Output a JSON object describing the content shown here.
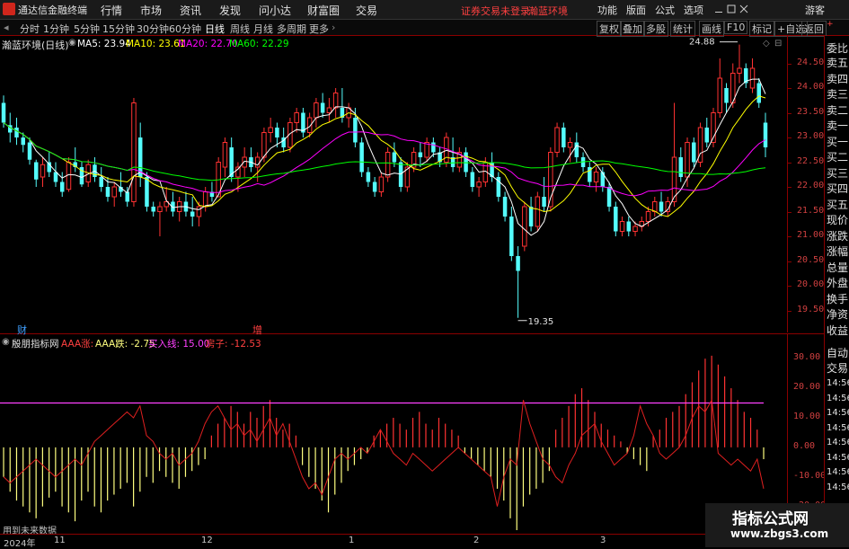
{
  "titlebar": {
    "app_title": "通达信金融终端",
    "menus": [
      "行情",
      "市场",
      "资讯",
      "发现",
      "问小达",
      "财富圈",
      "交易"
    ],
    "warning": "证券交易未登录",
    "stock_name": "瀚蓝环境",
    "right_menus": [
      "功能",
      "版面",
      "公式",
      "选项"
    ],
    "user": "游客"
  },
  "toolbar": {
    "periods": [
      "分时",
      "1分钟",
      "5分钟",
      "15分钟",
      "30分钟",
      "60分钟",
      "日线",
      "周线",
      "月线",
      "多周期",
      "更多"
    ],
    "selected": "日线",
    "right_buttons": [
      "复权",
      "叠加",
      "多股",
      "统计",
      "画线",
      "F10",
      "标记",
      "+自选",
      "返回"
    ]
  },
  "main_legend": {
    "title": "瀚蓝环境(日线)",
    "ma": [
      {
        "label": "MA5: 23.94",
        "color": "#ffffff"
      },
      {
        "label": "MA10: 23.61",
        "color": "#ffff00"
      },
      {
        "label": "MA20: 22.70",
        "color": "#ff00ff"
      },
      {
        "label": "MA60: 22.29",
        "color": "#00ff00"
      }
    ]
  },
  "sub_legend": {
    "title": "殷朋指标网",
    "items": [
      {
        "label": "AAA涨: ",
        "color": "#ff4040"
      },
      {
        "label": "AAA跌: -2.75",
        "color": "#ffff80"
      },
      {
        "label": "买入线: 15.00",
        "color": "#ff40ff"
      },
      {
        "label": "房子: -12.53",
        "color": "#ff4040"
      }
    ]
  },
  "annotations": {
    "high_label": "24.88",
    "low_label": "19.35",
    "marker_cai": "财",
    "marker_zeng": "增",
    "future_data": "用到未来数据"
  },
  "main_axis": {
    "ticks": [
      "24.50",
      "24.00",
      "23.50",
      "23.00",
      "22.50",
      "22.00",
      "21.50",
      "21.00",
      "20.50",
      "20.00",
      "19.50"
    ]
  },
  "sub_axis": {
    "ticks": [
      "30.00",
      "20.00",
      "10.00",
      "0.00",
      "-10.00",
      "-20.00"
    ]
  },
  "x_labels": {
    "year": "2024年",
    "months": [
      "11",
      "12",
      "1",
      "2",
      "3"
    ]
  },
  "right_panel": {
    "top": "委比",
    "items": [
      "卖五",
      "卖四",
      "卖三",
      "卖二",
      "卖一",
      "买一",
      "买二",
      "买三",
      "买四",
      "买五",
      "现价",
      "涨跌",
      "涨幅",
      "总量",
      "外盘",
      "换手",
      "净资",
      "收益"
    ],
    "auto": "自动",
    "trade": "交易",
    "times": [
      "14:56",
      "14:56",
      "14:56",
      "14:56",
      "14:56",
      "14:56",
      "14:56",
      "14:56"
    ]
  },
  "watermark": {
    "line1": "指标公式网",
    "line2": "www.zbgs3.com"
  },
  "chart_data": [
    {
      "type": "candlestick",
      "title": "瀚蓝环境(日线)",
      "ylim": [
        19.2,
        24.8
      ],
      "high": 24.88,
      "low": 19.35,
      "ohlc": [
        [
          23.7,
          23.85,
          23.2,
          23.3
        ],
        [
          23.25,
          23.5,
          22.9,
          23.1
        ],
        [
          23.2,
          23.4,
          22.85,
          23.0
        ],
        [
          23.0,
          23.1,
          22.7,
          22.85
        ],
        [
          22.9,
          23.0,
          22.45,
          22.55
        ],
        [
          22.5,
          22.55,
          22.0,
          22.15
        ],
        [
          22.2,
          22.6,
          22.0,
          22.45
        ],
        [
          22.5,
          22.7,
          22.2,
          22.3
        ],
        [
          22.3,
          22.5,
          22.0,
          22.1
        ],
        [
          22.1,
          22.3,
          21.8,
          21.9
        ],
        [
          21.95,
          22.6,
          21.9,
          22.5
        ],
        [
          22.5,
          22.8,
          22.3,
          22.4
        ],
        [
          22.4,
          22.5,
          22.0,
          22.05
        ],
        [
          22.1,
          22.55,
          22.0,
          22.45
        ],
        [
          22.45,
          22.6,
          22.1,
          22.2
        ],
        [
          22.2,
          22.4,
          21.9,
          22.0
        ],
        [
          22.0,
          22.2,
          21.7,
          21.8
        ],
        [
          21.8,
          22.1,
          21.6,
          22.0
        ],
        [
          22.0,
          22.3,
          21.8,
          21.9
        ],
        [
          21.9,
          22.0,
          21.6,
          21.7
        ],
        [
          21.7,
          23.8,
          21.6,
          23.7
        ],
        [
          23.0,
          23.3,
          22.0,
          22.2
        ],
        [
          22.2,
          22.3,
          21.5,
          21.6
        ],
        [
          21.6,
          21.7,
          21.4,
          21.5
        ],
        [
          21.5,
          21.7,
          21.0,
          21.6
        ],
        [
          21.6,
          22.0,
          21.5,
          21.7
        ],
        [
          21.7,
          21.9,
          21.4,
          21.5
        ],
        [
          21.5,
          21.8,
          21.3,
          21.7
        ],
        [
          21.7,
          21.9,
          21.4,
          21.5
        ],
        [
          21.5,
          21.8,
          21.2,
          21.4
        ],
        [
          21.4,
          21.7,
          21.2,
          21.6
        ],
        [
          21.6,
          22.0,
          21.5,
          21.9
        ],
        [
          21.9,
          22.1,
          21.7,
          21.8
        ],
        [
          21.8,
          22.6,
          21.8,
          22.5
        ],
        [
          22.4,
          23.0,
          22.2,
          22.9
        ],
        [
          22.8,
          23.0,
          22.1,
          22.2
        ],
        [
          22.2,
          22.5,
          21.9,
          22.4
        ],
        [
          22.4,
          22.8,
          22.2,
          22.6
        ],
        [
          22.6,
          22.8,
          22.3,
          22.4
        ],
        [
          22.4,
          22.7,
          22.1,
          22.6
        ],
        [
          22.6,
          23.2,
          22.5,
          23.1
        ],
        [
          23.1,
          23.4,
          22.9,
          23.2
        ],
        [
          23.2,
          23.3,
          22.8,
          23.0
        ],
        [
          23.0,
          23.2,
          22.7,
          22.8
        ],
        [
          22.8,
          23.4,
          22.7,
          23.3
        ],
        [
          23.3,
          23.6,
          23.1,
          23.5
        ],
        [
          23.5,
          23.6,
          23.0,
          23.1
        ],
        [
          23.1,
          23.5,
          23.0,
          23.4
        ],
        [
          23.4,
          23.8,
          23.2,
          23.7
        ],
        [
          23.7,
          23.9,
          23.4,
          23.5
        ],
        [
          23.5,
          23.8,
          23.3,
          23.6
        ],
        [
          23.6,
          24.0,
          23.4,
          23.9
        ],
        [
          23.6,
          24.0,
          23.3,
          23.4
        ],
        [
          23.4,
          23.7,
          23.2,
          23.6
        ],
        [
          23.4,
          23.6,
          22.8,
          22.9
        ],
        [
          22.9,
          23.0,
          22.2,
          22.3
        ],
        [
          22.3,
          22.4,
          22.0,
          22.1
        ],
        [
          22.1,
          22.2,
          21.8,
          21.9
        ],
        [
          21.9,
          22.3,
          21.8,
          22.2
        ],
        [
          22.2,
          22.8,
          22.1,
          22.7
        ],
        [
          22.7,
          22.9,
          22.4,
          22.5
        ],
        [
          22.5,
          22.6,
          21.9,
          22.0
        ],
        [
          22.0,
          22.5,
          21.9,
          22.4
        ],
        [
          22.4,
          22.8,
          22.3,
          22.7
        ],
        [
          22.7,
          22.9,
          22.4,
          22.6
        ],
        [
          22.6,
          23.0,
          22.5,
          22.9
        ],
        [
          22.9,
          23.0,
          22.6,
          22.7
        ],
        [
          22.7,
          22.8,
          22.4,
          22.5
        ],
        [
          22.5,
          23.1,
          22.4,
          23.0
        ],
        [
          22.6,
          23.0,
          22.3,
          22.4
        ],
        [
          22.4,
          22.8,
          22.3,
          22.7
        ],
        [
          22.7,
          22.8,
          22.2,
          22.3
        ],
        [
          22.3,
          22.4,
          21.9,
          22.0
        ],
        [
          22.0,
          22.2,
          21.8,
          22.1
        ],
        [
          22.1,
          22.6,
          22.0,
          22.5
        ],
        [
          22.5,
          22.7,
          22.1,
          22.2
        ],
        [
          22.2,
          22.3,
          21.7,
          21.8
        ],
        [
          21.8,
          21.9,
          21.3,
          21.4
        ],
        [
          21.4,
          21.6,
          20.5,
          20.6
        ],
        [
          20.6,
          20.8,
          19.35,
          20.3
        ],
        [
          20.8,
          21.7,
          20.7,
          21.6
        ],
        [
          21.6,
          21.8,
          21.1,
          21.2
        ],
        [
          21.2,
          21.9,
          21.1,
          21.8
        ],
        [
          21.8,
          22.2,
          21.5,
          21.6
        ],
        [
          21.6,
          22.8,
          21.5,
          22.7
        ],
        [
          22.7,
          23.3,
          22.6,
          23.2
        ],
        [
          23.2,
          23.3,
          22.7,
          22.8
        ],
        [
          22.8,
          23.0,
          22.5,
          22.9
        ],
        [
          22.9,
          23.1,
          22.5,
          22.6
        ],
        [
          22.6,
          22.7,
          22.3,
          22.4
        ],
        [
          22.4,
          22.5,
          22.0,
          22.1
        ],
        [
          22.1,
          22.4,
          21.9,
          22.3
        ],
        [
          22.3,
          22.4,
          21.9,
          22.0
        ],
        [
          22.0,
          22.1,
          21.5,
          21.6
        ],
        [
          21.6,
          21.7,
          21.0,
          21.1
        ],
        [
          21.1,
          21.4,
          21.0,
          21.3
        ],
        [
          21.3,
          21.4,
          21.0,
          21.1
        ],
        [
          21.1,
          21.3,
          21.0,
          21.2
        ],
        [
          21.2,
          21.4,
          21.1,
          21.3
        ],
        [
          21.3,
          21.6,
          21.2,
          21.5
        ],
        [
          21.5,
          21.8,
          21.4,
          21.7
        ],
        [
          21.7,
          21.9,
          21.4,
          21.5
        ],
        [
          21.5,
          21.8,
          21.4,
          21.7
        ],
        [
          21.7,
          23.7,
          21.6,
          22.6
        ],
        [
          22.6,
          22.8,
          22.1,
          22.2
        ],
        [
          22.2,
          23.0,
          22.0,
          22.9
        ],
        [
          22.9,
          23.0,
          22.4,
          22.5
        ],
        [
          22.5,
          23.3,
          22.4,
          23.2
        ],
        [
          23.2,
          23.4,
          22.8,
          22.9
        ],
        [
          22.9,
          23.6,
          22.8,
          23.5
        ],
        [
          23.5,
          24.6,
          23.4,
          24.2
        ],
        [
          24.0,
          24.1,
          23.5,
          23.7
        ],
        [
          23.7,
          24.5,
          23.6,
          24.3
        ],
        [
          24.3,
          24.88,
          24.1,
          24.4
        ],
        [
          24.4,
          24.5,
          24.0,
          24.1
        ],
        [
          24.0,
          24.6,
          23.9,
          24.4
        ],
        [
          24.1,
          24.2,
          23.6,
          23.7
        ],
        [
          23.3,
          23.5,
          22.6,
          22.8
        ]
      ],
      "ma5_last": 23.94,
      "ma10_last": 23.61,
      "ma20_last": 22.7,
      "ma60_last": 22.29
    },
    {
      "type": "bar",
      "title": "殷朋指标网",
      "ylim": [
        -28,
        34
      ],
      "buy_line": 15.0,
      "bars": [
        -10,
        -15,
        -18,
        -20,
        -22,
        -24,
        -20,
        -17,
        -15,
        -20,
        -22,
        -25,
        -18,
        -15,
        -20,
        -22,
        -18,
        -16,
        -14,
        -12,
        -20,
        -15,
        -10,
        -12,
        -8,
        -10,
        -12,
        -14,
        -10,
        -8,
        -6,
        -4,
        4,
        8,
        10,
        14,
        12,
        8,
        12,
        10,
        14,
        16,
        10,
        6,
        8,
        4,
        -6,
        -10,
        -14,
        -18,
        -22,
        -16,
        -12,
        -8,
        -6,
        -4,
        -2,
        4,
        6,
        8,
        10,
        8,
        6,
        10,
        12,
        8,
        6,
        10,
        8,
        6,
        4,
        -2,
        -4,
        -6,
        -8,
        -10,
        -14,
        -18,
        -24,
        -28,
        -20,
        -16,
        -14,
        -12,
        -8,
        6,
        10,
        14,
        18,
        20,
        16,
        12,
        8,
        6,
        4,
        2,
        -2,
        -4,
        -6,
        -8,
        4,
        6,
        10,
        12,
        14,
        18,
        22,
        26,
        30,
        31,
        28,
        24,
        20,
        16,
        12,
        10,
        6,
        -4
      ],
      "house_line": [
        -10,
        -12,
        -10,
        -8,
        -6,
        -4,
        -6,
        -8,
        -10,
        -8,
        -6,
        -4,
        -6,
        -2,
        2,
        4,
        6,
        8,
        10,
        12,
        10,
        14,
        4,
        2,
        -2,
        -4,
        -2,
        -6,
        -4,
        -2,
        2,
        8,
        12,
        14,
        10,
        6,
        8,
        4,
        6,
        2,
        6,
        10,
        4,
        8,
        2,
        -4,
        -10,
        -14,
        -12,
        -16,
        -10,
        -4,
        -2,
        -4,
        -2,
        0,
        -2,
        2,
        6,
        2,
        -2,
        -4,
        -6,
        -2,
        -4,
        -6,
        -8,
        -6,
        -4,
        -2,
        0,
        -2,
        -4,
        -6,
        -8,
        -10,
        -20,
        -10,
        -4,
        -6,
        16,
        8,
        2,
        -4,
        -6,
        -10,
        -12,
        -6,
        -2,
        4,
        6,
        8,
        2,
        -2,
        -6,
        -4,
        -2,
        4,
        14,
        8,
        4,
        -2,
        -4,
        -2,
        0,
        4,
        10,
        14,
        12,
        16,
        -2,
        -4,
        -6,
        -4,
        -6,
        -8,
        -4,
        -14
      ]
    }
  ]
}
